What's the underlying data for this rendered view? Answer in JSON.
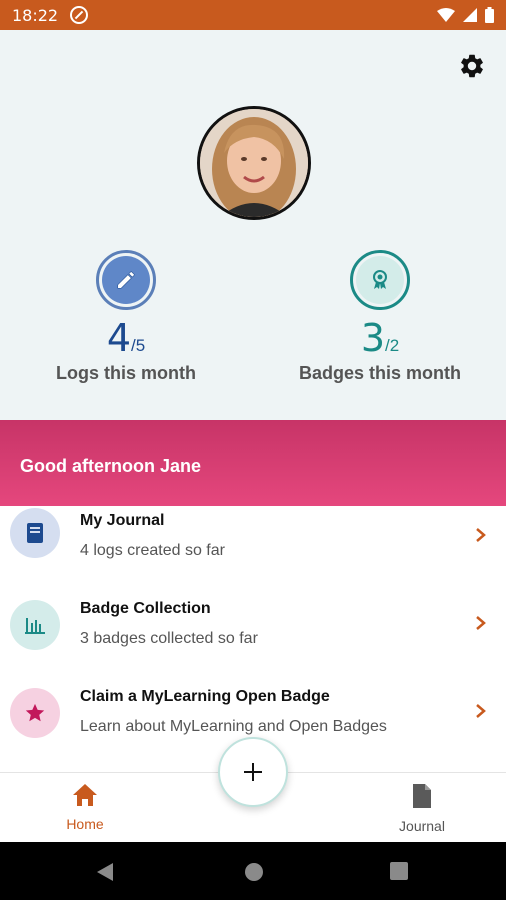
{
  "status_bar": {
    "time": "18:22",
    "icons": [
      "dnd-icon",
      "wifi-icon",
      "signal-icon",
      "battery-icon"
    ]
  },
  "profile": {
    "settings_icon": "gear-icon",
    "avatar_alt": "profile photo"
  },
  "stats": {
    "logs": {
      "value": "4",
      "total": "/5",
      "label": "Logs this month",
      "icon": "pencil-icon"
    },
    "badges": {
      "value": "3",
      "total": "/2",
      "label": "Badges this month",
      "icon": "badge-icon"
    }
  },
  "greeting": "Good afternoon Jane",
  "menu": [
    {
      "title": "My Journal",
      "subtitle": "4 logs created so far",
      "icon": "book-icon"
    },
    {
      "title": "Badge Collection",
      "subtitle": "3 badges collected so far",
      "icon": "chart-icon"
    },
    {
      "title": "Claim a MyLearning Open Badge",
      "subtitle": "Learn about MyLearning and Open Badges",
      "icon": "star-icon"
    }
  ],
  "bottom_nav": {
    "home_label": "Home",
    "journal_label": "Journal",
    "fab_icon": "plus-icon"
  },
  "colors": {
    "status_bar": "#c85a1e",
    "accent_blue": "#1d4a8f",
    "accent_teal": "#1b8a86",
    "greeting_pink": "#e5477d"
  }
}
